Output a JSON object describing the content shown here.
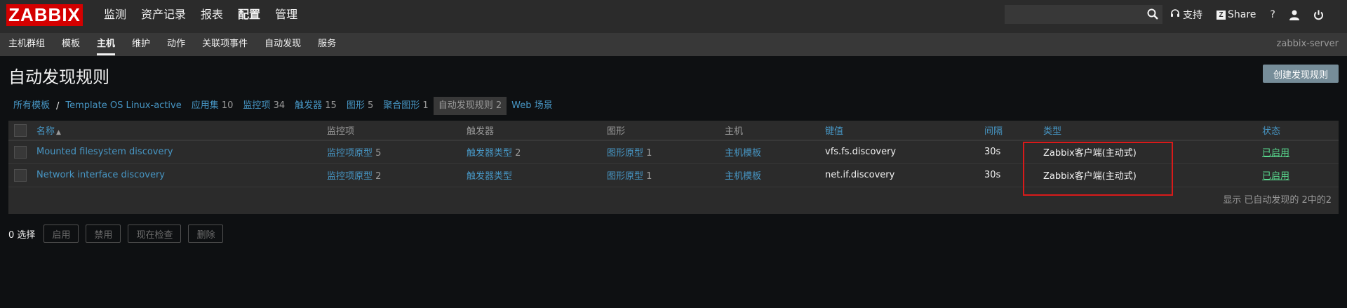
{
  "header": {
    "logo": "ZABBIX",
    "menu": [
      "监测",
      "资产记录",
      "报表",
      "配置",
      "管理"
    ],
    "selected_menu": "配置",
    "search": {
      "value": "",
      "placeholder": ""
    },
    "support_label": "支持",
    "share_label": "Share",
    "help_label": "?"
  },
  "subnav": {
    "items": [
      "主机群组",
      "模板",
      "主机",
      "维护",
      "动作",
      "关联项事件",
      "自动发现",
      "服务"
    ],
    "selected": "主机",
    "server": "zabbix-server"
  },
  "page": {
    "title": "自动发现规则",
    "create_button": "创建发现规则"
  },
  "breadcrumbs": {
    "all_templates": "所有模板",
    "separator": "/",
    "template": "Template OS Linux-active",
    "tabs": [
      {
        "label": "应用集",
        "count": "10"
      },
      {
        "label": "监控项",
        "count": "34"
      },
      {
        "label": "触发器",
        "count": "15"
      },
      {
        "label": "图形",
        "count": "5"
      },
      {
        "label": "聚合图形",
        "count": "1"
      },
      {
        "label": "自动发现规则",
        "count": "2"
      },
      {
        "label": "Web 场景",
        "count": ""
      }
    ],
    "active": "自动发现规则"
  },
  "table": {
    "headers": {
      "name": "名称",
      "items": "监控项",
      "triggers": "触发器",
      "graphs": "图形",
      "hosts": "主机",
      "key": "键值",
      "interval": "间隔",
      "type": "类型",
      "status": "状态"
    },
    "sort_indicator": "▲",
    "rows": [
      {
        "name": "Mounted filesystem discovery",
        "items_label": "监控项原型",
        "items_count": "5",
        "triggers_label": "触发器类型",
        "triggers_count": "2",
        "graphs_label": "图形原型",
        "graphs_count": "1",
        "hosts_label": "主机模板",
        "key": "vfs.fs.discovery",
        "interval": "30s",
        "type": "Zabbix客户端(主动式)",
        "status": "已启用"
      },
      {
        "name": "Network interface discovery",
        "items_label": "监控项原型",
        "items_count": "2",
        "triggers_label": "触发器类型",
        "triggers_count": "",
        "graphs_label": "图形原型",
        "graphs_count": "1",
        "hosts_label": "主机模板",
        "key": "net.if.discovery",
        "interval": "30s",
        "type": "Zabbix客户端(主动式)",
        "status": "已启用"
      }
    ],
    "footer": "显示 已自动发现的 2中的2"
  },
  "actions": {
    "selected_count": "0 选择",
    "enable": "启用",
    "disable": "禁用",
    "check_now": "现在检查",
    "delete": "删除"
  },
  "colors": {
    "brand": "#d40000",
    "link": "#4796c4",
    "enabled": "#59db8f",
    "highlight": "#d91a1a"
  }
}
